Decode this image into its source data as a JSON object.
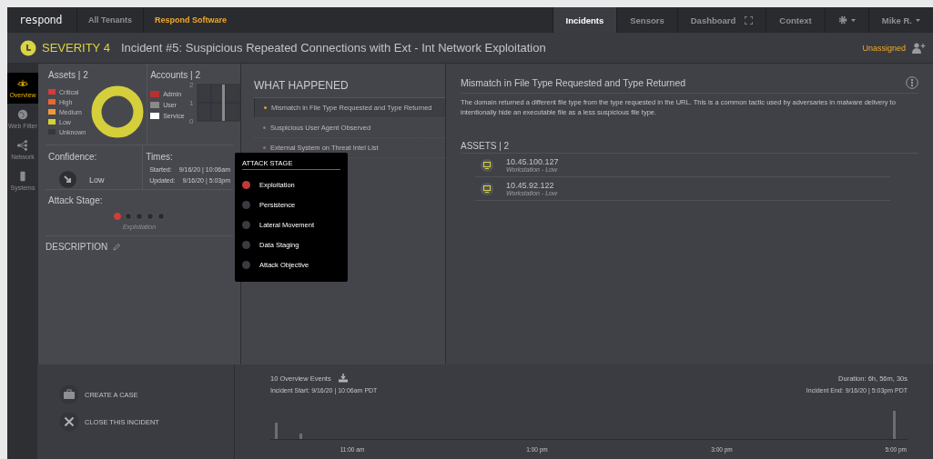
{
  "nav": {
    "logo": "respond",
    "tenants": [
      {
        "label": "All Tenants",
        "selected": false
      },
      {
        "label": "Respond Software",
        "selected": true
      }
    ],
    "tabs": [
      {
        "label": "Incidents",
        "selected": true,
        "kind": "text"
      },
      {
        "label": "Sensors",
        "selected": false,
        "kind": "text"
      },
      {
        "label": "Dashboard",
        "selected": false,
        "kind": "expand"
      },
      {
        "label": "Context",
        "selected": false,
        "kind": "text"
      }
    ],
    "user": "Mike R."
  },
  "header": {
    "severity": "SEVERITY 4",
    "title": "Incident #5: Suspicious Repeated Connections with Ext - Int Network Exploitation",
    "assignee": "Unassigned"
  },
  "sidebar": {
    "items": [
      {
        "label": "Overview",
        "selected": true,
        "kind": "eye"
      },
      {
        "label": "Web Filter",
        "selected": false,
        "kind": "globe"
      },
      {
        "label": "Network",
        "selected": false,
        "kind": "network"
      },
      {
        "label": "Systems",
        "selected": false,
        "kind": "phone"
      }
    ]
  },
  "assets": {
    "title": "Assets | 2",
    "legend": [
      {
        "label": "Critical",
        "color": "#d63a3a"
      },
      {
        "label": "High",
        "color": "#e8672f"
      },
      {
        "label": "Medium",
        "color": "#f0993a"
      },
      {
        "label": "Low",
        "color": "#d4cf3a"
      },
      {
        "label": "Unknown",
        "color": "#36373b"
      }
    ]
  },
  "accounts": {
    "title": "Accounts | 2",
    "legend": [
      {
        "label": "Admin",
        "color": "#b83030"
      },
      {
        "label": "User",
        "color": "#8a8a8a"
      },
      {
        "label": "Service",
        "color": "#ffffff"
      }
    ],
    "chart_data": {
      "type": "bar",
      "stacked": true,
      "ylim": [
        0,
        2
      ],
      "yticks": [
        0,
        1,
        2
      ],
      "series": [
        {
          "color": "#8a8a8a",
          "values": [
            2
          ]
        }
      ]
    }
  },
  "confidence": {
    "label": "Confidence:",
    "value": "Low"
  },
  "times": {
    "label": "Times:",
    "rows": [
      {
        "name": "Started:",
        "value": "9/16/20 | 10:06am"
      },
      {
        "name": "Updated:",
        "value": "9/16/20 | 5:03pm"
      }
    ]
  },
  "attack_stage": {
    "label": "Attack Stage:",
    "current": "Exploitation",
    "popup_title": "ATTACK STAGE",
    "stages": [
      {
        "name": "Exploitation",
        "selected": true
      },
      {
        "name": "Persistence",
        "selected": false
      },
      {
        "name": "Lateral Movement",
        "selected": false
      },
      {
        "name": "Data Staging",
        "selected": false
      },
      {
        "name": "Attack Objective",
        "selected": false
      }
    ]
  },
  "description": {
    "label": "DESCRIPTION"
  },
  "what_happened": {
    "title": "WHAT HAPPENED",
    "items": [
      {
        "label": "Mismatch in File Type Requested and Type Returned",
        "selected": true
      },
      {
        "label": "Suspicious User Agent Observed",
        "selected": false
      },
      {
        "label": "External System on Threat Intel List",
        "selected": false
      }
    ]
  },
  "detail": {
    "title": "Mismatch in File Type Requested and Type Returned",
    "text": "The domain returned a different file type from the type requested in the URL. This is a common tactic used by adversaries in malware delivery to intentionally hide an executable file as a less suspicious file type.",
    "assets_title": "ASSETS | 2",
    "assets": [
      {
        "ip": "10.45.100.127",
        "info": "Workstation - Low"
      },
      {
        "ip": "10.45.92.122",
        "info": "Workstation - Low"
      }
    ]
  },
  "actions": [
    {
      "label": "CREATE A CASE",
      "kind": "case"
    },
    {
      "label": "CLOSE THIS INCIDENT",
      "kind": "close"
    }
  ],
  "timeline": {
    "events": "10 Overview Events",
    "duration": "Duration: 6h, 56m, 30s",
    "start": "Incident Start: 9/16/20 | 10:06am PDT",
    "end": "Incident End: 9/16/20 | 5:03pm PDT",
    "ticks": [
      "11:00 am",
      "1:00 pm",
      "3:00 pm",
      "5:00 pm"
    ]
  }
}
